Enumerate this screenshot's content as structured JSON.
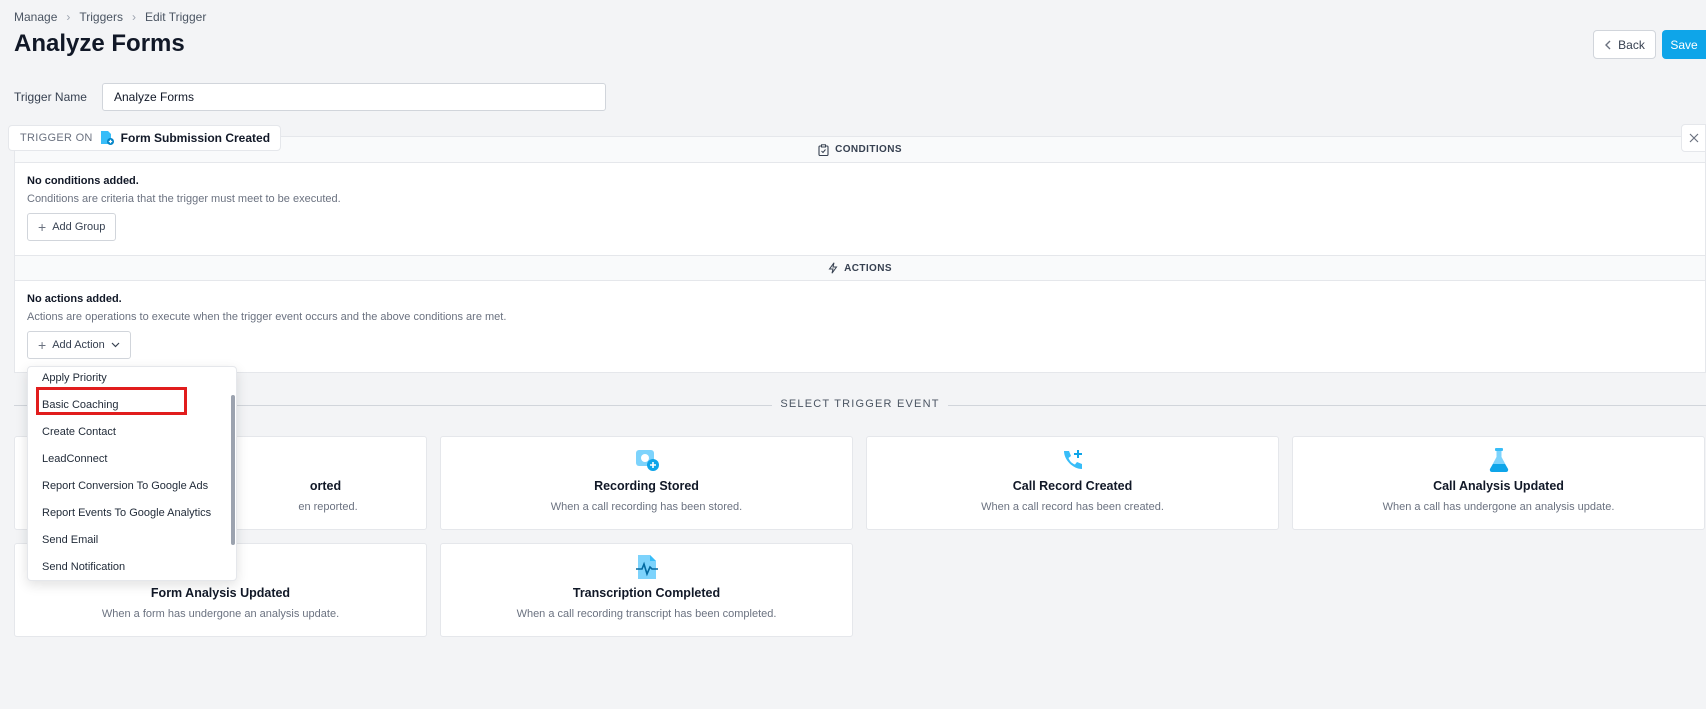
{
  "breadcrumb": {
    "items": [
      "Manage",
      "Triggers",
      "Edit Trigger"
    ]
  },
  "page": {
    "title": "Analyze Forms"
  },
  "header_actions": {
    "back_label": "Back",
    "save_label": "Save"
  },
  "form": {
    "trigger_name_label": "Trigger Name",
    "trigger_name_value": "Analyze Forms"
  },
  "trigger_on": {
    "label": "TRIGGER ON",
    "value": "Form Submission Created"
  },
  "conditions": {
    "heading": "CONDITIONS",
    "empty_title": "No conditions added.",
    "empty_desc": "Conditions are criteria that the trigger must meet to be executed.",
    "add_group_label": "Add Group"
  },
  "actions": {
    "heading": "ACTIONS",
    "empty_title": "No actions added.",
    "empty_desc": "Actions are operations to execute when the trigger event occurs and the above conditions are met.",
    "add_action_label": "Add Action"
  },
  "action_menu": {
    "items": [
      "Apply Priority",
      "Basic Coaching",
      "Create Contact",
      "LeadConnect",
      "Report Conversion To Google Ads",
      "Report Events To Google Analytics",
      "Send Email",
      "Send Notification"
    ],
    "highlighted": "Basic Coaching"
  },
  "select_event": {
    "heading": "SELECT TRIGGER EVENT",
    "cards": [
      {
        "title": "orted",
        "desc": "en reported.",
        "icon": "partially-hidden"
      },
      {
        "title": "Recording Stored",
        "desc": "When a call recording has been stored.",
        "icon": "recording-stored-icon"
      },
      {
        "title": "Call Record Created",
        "desc": "When a call record has been created.",
        "icon": "phone-plus-icon"
      },
      {
        "title": "Call Analysis Updated",
        "desc": "When a call has undergone an analysis update.",
        "icon": "flask-icon"
      },
      {
        "title": "Form Analysis Updated",
        "desc": "When a form has undergone an analysis update.",
        "icon": "partially-hidden"
      },
      {
        "title": "Transcription Completed",
        "desc": "When a call recording transcript has been completed.",
        "icon": "transcript-file-icon"
      }
    ]
  },
  "colors": {
    "accent": "#0ea5e9",
    "icon_blue": "#38bdf8",
    "highlight": "#e11d1d"
  }
}
